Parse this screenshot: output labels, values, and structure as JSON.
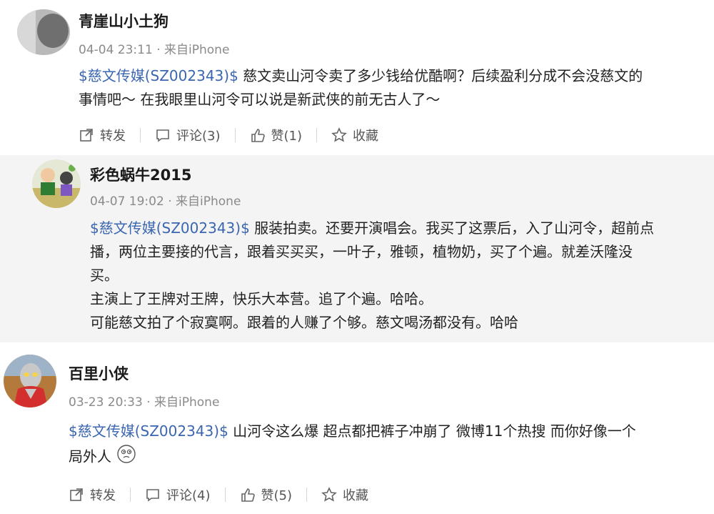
{
  "posts": [
    {
      "user": "青崖山小土狗",
      "time": "04-04 23:11",
      "source": "来自iPhone",
      "tag": "$慈文传媒(SZ002343)$",
      "text_first": " 慈文卖山河令卖了多少钱给优酷啊？后续盈利分成不会没慈文的",
      "text_line2": "事情吧～ 在我眼里山河令可以说是新武侠的前无古人了～",
      "actions": {
        "repost": "转发",
        "comment": "评论(3)",
        "like": "赞(1)",
        "favorite": "收藏"
      }
    },
    {
      "user": "彩色蜗牛2015",
      "time": "04-07 19:02",
      "source": "来自iPhone",
      "tag": "$慈文传媒(SZ002343)$",
      "text_first": " 服装拍卖。还要开演唱会。我买了这票后，入了山河令，超前点",
      "text_line2": "播，两位主要接的代言，跟着买买买，一叶子，雅顿，植物奶，买了个遍。就差沃隆没",
      "text_line3": "买。",
      "text_line4": "主演上了王牌对王牌，快乐大本营。追了个遍。哈哈。",
      "text_line5": "可能慈文拍了个寂寞啊。跟着的人赚了个够。慈文喝汤都没有。哈哈"
    },
    {
      "user": "百里小侠",
      "time": "03-23 20:33",
      "source": "来自iPhone",
      "tag": "$慈文传媒(SZ002343)$",
      "text_first": " 山河令这么爆 超点都把裤子冲崩了 微博11个热搜 而你好像一个",
      "text_line2": "局外人",
      "actions": {
        "repost": "转发",
        "comment": "评论(4)",
        "like": "赞(5)",
        "favorite": "收藏"
      }
    }
  ],
  "meta_separator": "·",
  "colors": {
    "tag": "#3a66b0",
    "meta": "#8a8a8a",
    "alt_bg": "#f4f4f4"
  },
  "icons": [
    "repost-icon",
    "comment-icon",
    "like-icon",
    "favorite-icon",
    "thinking-emoji"
  ]
}
